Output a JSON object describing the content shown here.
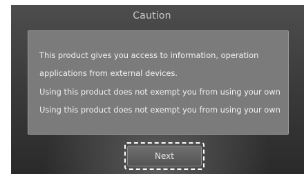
{
  "title": "Caution",
  "messages": [
    "This product gives you access to information, operation",
    "applications from external devices.",
    "Using this product does not exempt you from using your own",
    "Using this product does not exempt you from using your own"
  ],
  "buttons": {
    "next_label": "Next"
  }
}
